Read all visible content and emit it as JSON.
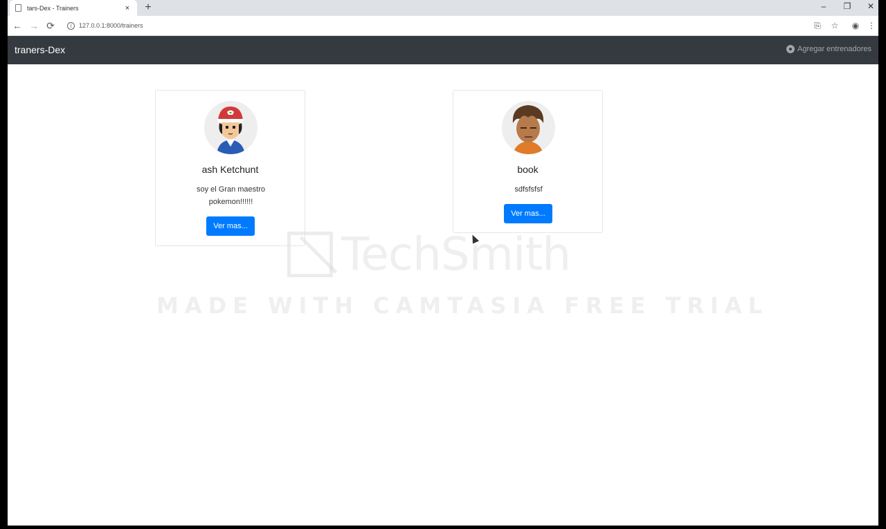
{
  "browser": {
    "tab_title": "tars-Dex - Trainers",
    "tab_close": "×",
    "new_tab": "+",
    "window_controls": {
      "minimize": "–",
      "restore": "❐",
      "close": "✕"
    },
    "nav": {
      "back": "←",
      "forward": "→",
      "reload": "⟳"
    },
    "url": "127.0.0.1:8000/trainers",
    "right_icons": {
      "translate": "⎘",
      "bookmark": "☆",
      "account": "◉",
      "menu": "⋮"
    }
  },
  "navbar": {
    "brand": "traners-Dex",
    "action_label": "Agregar entrenadores",
    "action_icon": "gear-icon"
  },
  "trainers": [
    {
      "name": "ash Ketchunt",
      "description": "soy el Gran maestro pokemon!!!!!!",
      "button_label": "Ver mas..."
    },
    {
      "name": "book",
      "description": "sdfsfsfsf",
      "button_label": "Ver mas..."
    }
  ],
  "watermark": {
    "logo_text": "TechSmith",
    "subtitle": "MADE WITH CAMTASIA FREE TRIAL"
  },
  "colors": {
    "navbar_bg": "#343a40",
    "primary_button": "#007bff",
    "tabstrip_bg": "#dee1e6"
  }
}
